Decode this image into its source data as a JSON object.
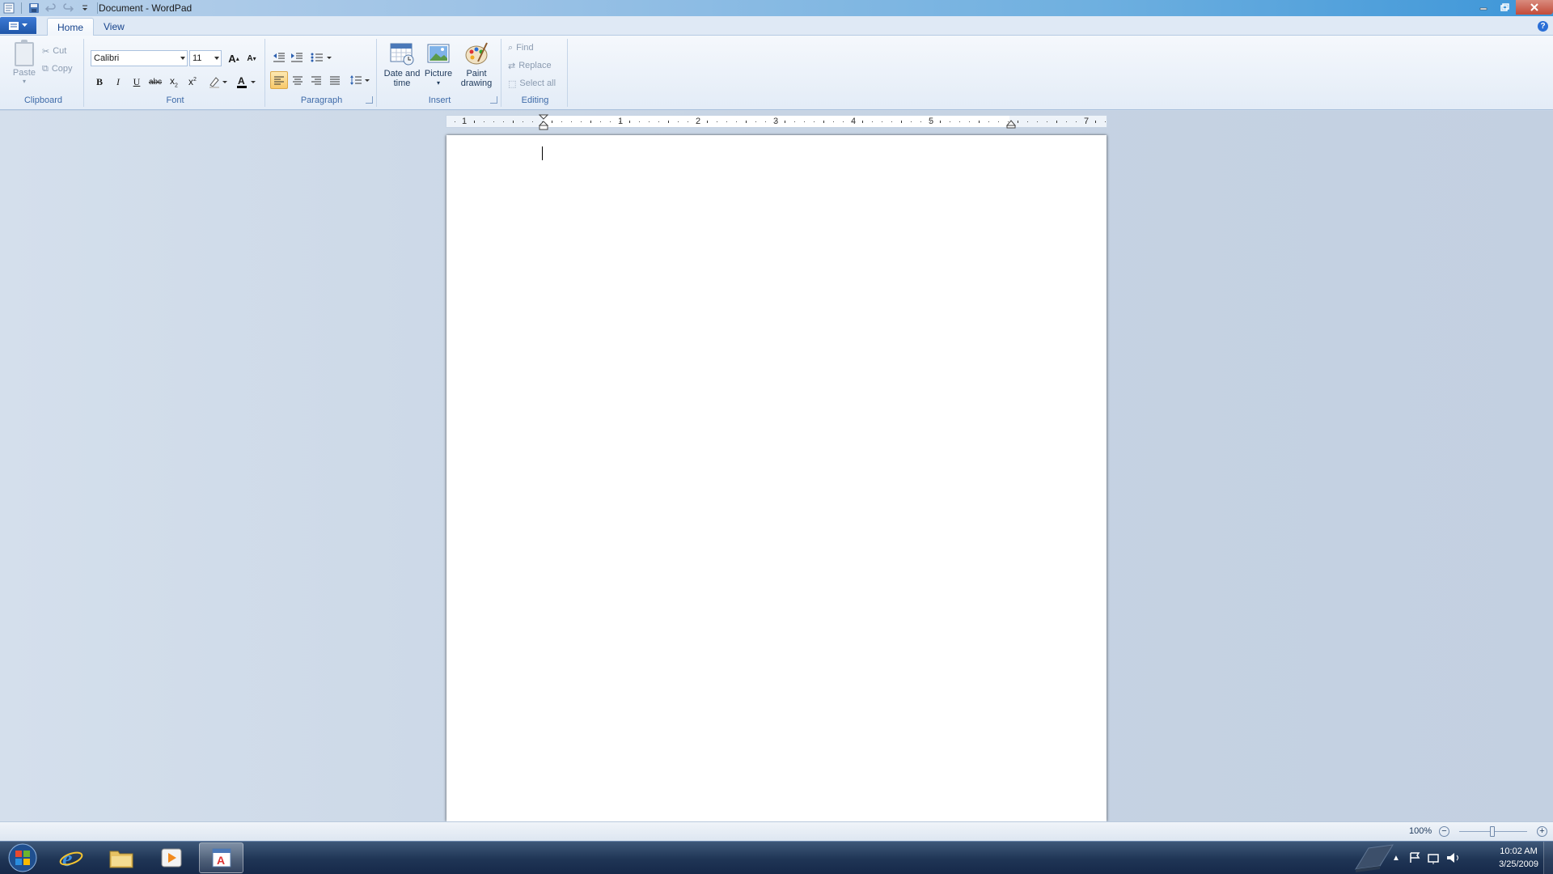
{
  "window": {
    "title": "Document - WordPad"
  },
  "tabs": [
    {
      "label": "Home",
      "active": true
    },
    {
      "label": "View",
      "active": false
    }
  ],
  "clipboard": {
    "group_label": "Clipboard",
    "paste": "Paste",
    "cut": "Cut",
    "copy": "Copy"
  },
  "font": {
    "group_label": "Font",
    "family": "Calibri",
    "size": "11",
    "bold": "B",
    "italic": "I",
    "underline": "U",
    "strike": "abc"
  },
  "paragraph": {
    "group_label": "Paragraph"
  },
  "insert": {
    "group_label": "Insert",
    "datetime_l1": "Date and",
    "datetime_l2": "time",
    "picture": "Picture",
    "paint_l1": "Paint",
    "paint_l2": "drawing"
  },
  "editing": {
    "group_label": "Editing",
    "find": "Find",
    "replace": "Replace",
    "select_all": "Select all"
  },
  "ruler": {
    "labels": [
      "1",
      "1",
      "2",
      "3",
      "4",
      "5",
      "7"
    ]
  },
  "status": {
    "zoom": "100%"
  },
  "taskbar": {
    "time": "10:02 AM",
    "date": "3/25/2009"
  },
  "colors": {
    "accent": "#1f56a8",
    "highlight_active": "#f8c96a"
  }
}
